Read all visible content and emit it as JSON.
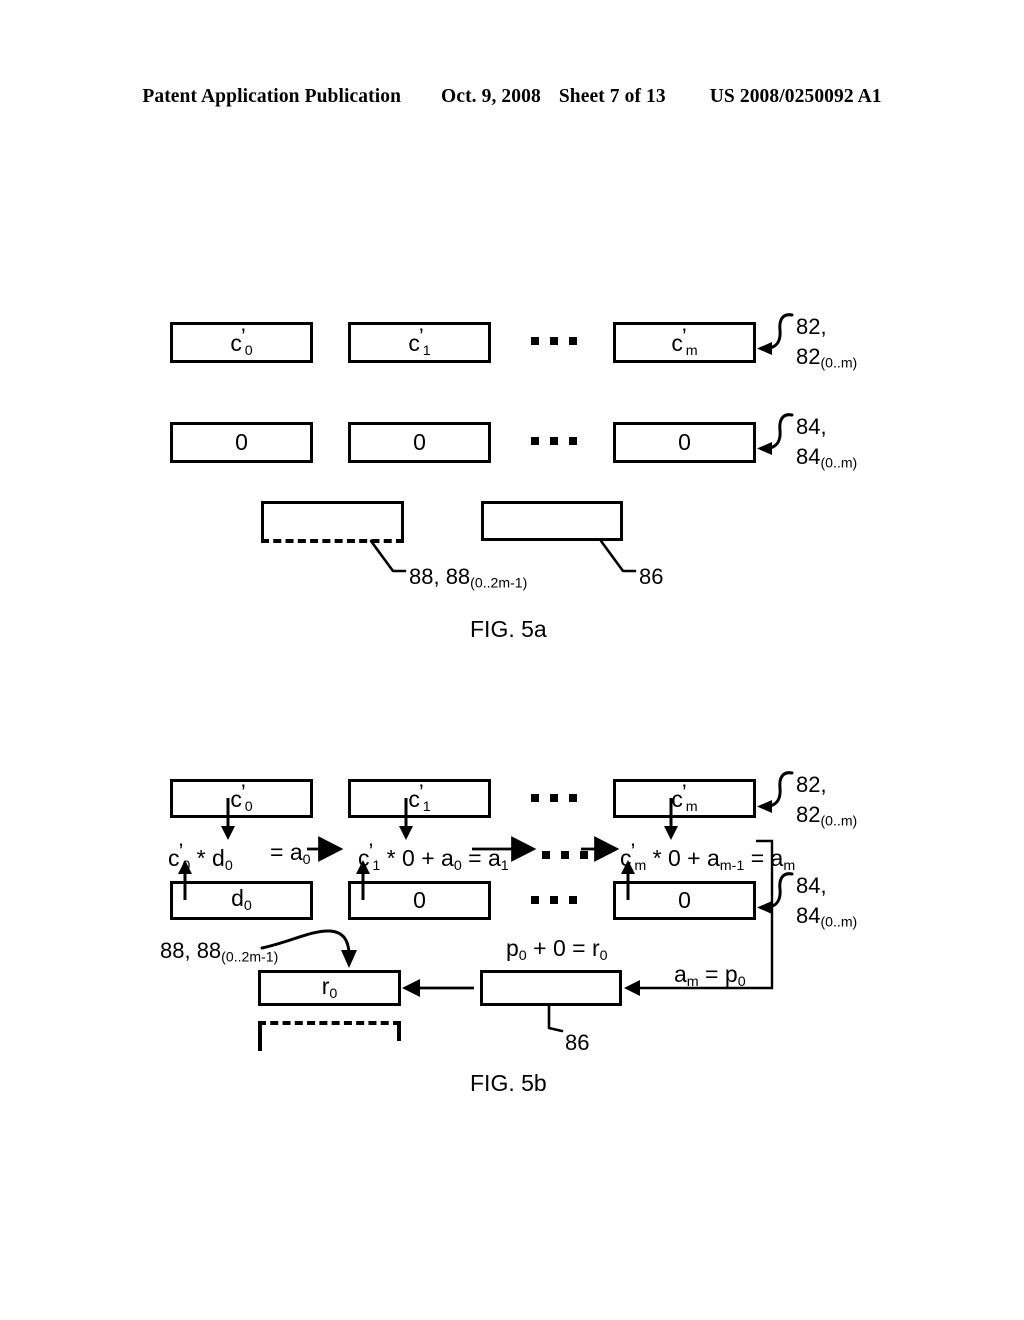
{
  "header": {
    "publication": "Patent Application Publication",
    "date": "Oct. 9, 2008",
    "sheet": "Sheet 7 of 13",
    "docnum": "US 2008/0250092 A1"
  },
  "figures": [
    {
      "id": "fig5a",
      "caption": "FIG. 5a",
      "rows": [
        {
          "name": "c-prime-row",
          "cells": [
            "c'0",
            "c'1",
            "c'm"
          ],
          "ref_label_line1": "82,",
          "ref_label_line2": "82",
          "ref_label_sub": "(0..m)"
        },
        {
          "name": "zero-row",
          "cells": [
            "0",
            "0",
            "0"
          ],
          "ref_label_line1": "84,",
          "ref_label_line2": "84",
          "ref_label_sub": "(0..m)"
        }
      ],
      "result_boxes": [
        {
          "name": "box-88",
          "text": "",
          "style": "dashed-bottom",
          "ref": "88, 88",
          "ref_sub": "(0..2m-1)"
        },
        {
          "name": "box-86",
          "text": "",
          "style": "solid",
          "ref": "86",
          "ref_sub": ""
        }
      ]
    },
    {
      "id": "fig5b",
      "caption": "FIG. 5b",
      "rows": [
        {
          "name": "c-prime-row",
          "cells": [
            "c'0",
            "c'1",
            "c'm"
          ],
          "ref_label_line1": "82,",
          "ref_label_line2": "82",
          "ref_label_sub": "(0..m)"
        },
        {
          "name": "operand-row",
          "cells": [
            "d0",
            "0",
            "0"
          ],
          "ref_label_line1": "84,",
          "ref_label_line2": "84",
          "ref_label_sub": "(0..m)"
        }
      ],
      "equations": [
        {
          "name": "eq-stage-0",
          "text": "c'0 * d0"
        },
        {
          "name": "eq-carry-0",
          "text": "= a0"
        },
        {
          "name": "eq-stage-1",
          "text": "c'1 * 0 + a0 = a1"
        },
        {
          "name": "eq-stage-m",
          "text": "c'm * 0 + am-1 = am"
        },
        {
          "name": "eq-accumulate",
          "text": "p0 + 0 = r0"
        },
        {
          "name": "eq-feedback",
          "text": "am = p0"
        }
      ],
      "result_boxes": [
        {
          "name": "box-r0",
          "text": "r0",
          "style": "solid",
          "ref": "88, 88",
          "ref_sub": "(0..2m-1)"
        },
        {
          "name": "box-86",
          "text": "",
          "style": "solid",
          "ref": "86",
          "ref_sub": ""
        }
      ]
    }
  ]
}
